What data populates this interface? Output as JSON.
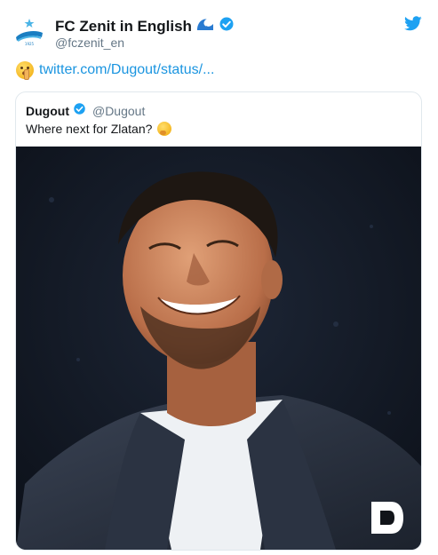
{
  "tweet": {
    "display_name": "FC Zenit in English",
    "handle": "@fczenit_en",
    "link_text": "twitter.com/Dugout/status/...",
    "brand_color": "#1da1f2",
    "link_color": "#1b95e0",
    "emoji_after_name": "wave-icon",
    "emoji_before_link": "shushing-face-icon"
  },
  "quote": {
    "display_name": "Dugout",
    "handle": "@Dugout",
    "text": "Where next for Zlatan?",
    "emoji": "thinking-face-icon"
  },
  "media": {
    "description_icon": "dugout-logo-icon"
  }
}
